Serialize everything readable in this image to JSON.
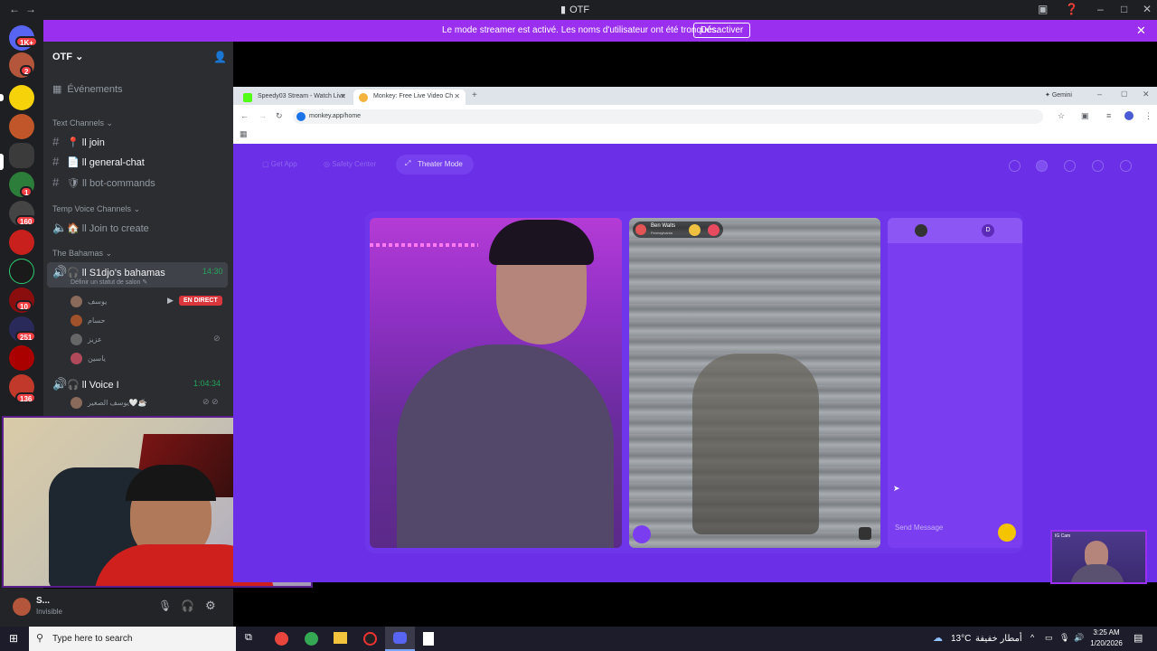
{
  "window": {
    "title": "OTF"
  },
  "banner": {
    "message": "Le mode streamer est activé. Les noms d'utilisateur ont été tronqués.",
    "button": "Désactiver"
  },
  "rail": {
    "badges": [
      "1K+",
      "2",
      "1",
      "160",
      "10",
      "251",
      "136"
    ]
  },
  "sidebar": {
    "server_name": "OTF",
    "events": "Événements",
    "text_category": "Text Channels",
    "text_channels": [
      {
        "emoji": "📍",
        "label": "ll join"
      },
      {
        "emoji": "📄",
        "label": "ll general-chat"
      },
      {
        "emoji": "🛡",
        "label": "ll bot-commands"
      }
    ],
    "temp_category": "Temp Voice Channels",
    "temp_channel": "ll Join to create",
    "bahamas_category": "The Bahamas",
    "voice1": {
      "label": "ll S1djo's bahamas",
      "time": "14:30",
      "status": "Définir un statut de salon"
    },
    "voice1_users": [
      "يوسف",
      "حسام",
      "عزيز",
      "ياسين"
    ],
    "live_badge": "EN DIRECT",
    "voice2": {
      "label": "ll Voice I",
      "time": "1:04:34"
    },
    "voice2_users": [
      "يوسف الصغير"
    ]
  },
  "userpanel": {
    "name": "S...",
    "status": "Invisible"
  },
  "browser": {
    "tabs": [
      {
        "label": "Speedy03 Stream - Watch Live"
      },
      {
        "label": "Monkey: Free Live Video Ch"
      }
    ],
    "gemini": "Gemini",
    "url": "monkey.app/home"
  },
  "monkey": {
    "nav": {
      "get_app": "Get App",
      "safety": "Safety Center",
      "theater": "Theater Mode"
    },
    "peer_name": "Ben Walts",
    "peer_sub": "Pennsylvania",
    "chat_tab_letter": "D",
    "send_placeholder": "Send Message"
  },
  "pip_label": "IG Cam",
  "taskbar": {
    "search_placeholder": "Type here to search",
    "weather_temp": "13°C",
    "weather_text": "أمطار خفيفة",
    "time": "3:25 AM",
    "date": "1/20/2026"
  },
  "colors": {
    "accent": "#9b2ff0",
    "monkey_bg": "#6a2fe6",
    "discord_dark": "#2b2d31",
    "live_red": "#da373c"
  }
}
